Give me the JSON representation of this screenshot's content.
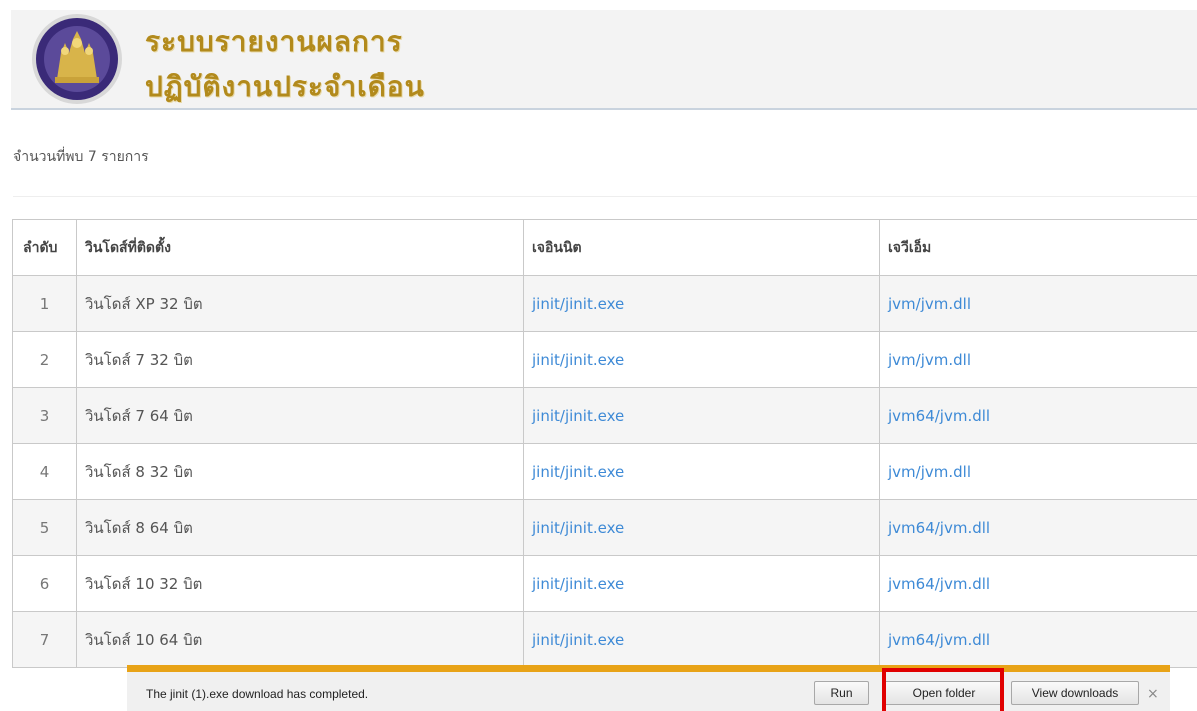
{
  "header": {
    "title_line1": "ระบบรายงานผลการ",
    "title_line2": "ปฏิบัติงานประจำเดือน"
  },
  "summary": {
    "count_text": "จำนวนที่พบ 7 รายการ"
  },
  "table": {
    "headers": [
      "ลำดับ",
      "วินโดส์ที่ติดตั้ง",
      "เจอินนิต",
      "เจวีเอ็ม"
    ],
    "rows": [
      {
        "no": "1",
        "os": "วินโดส์ XP 32 บิต",
        "jinit": "jinit/jinit.exe",
        "jvm": "jvm/jvm.dll"
      },
      {
        "no": "2",
        "os": "วินโดส์ 7 32 บิต",
        "jinit": "jinit/jinit.exe",
        "jvm": "jvm/jvm.dll"
      },
      {
        "no": "3",
        "os": "วินโดส์ 7 64 บิต",
        "jinit": "jinit/jinit.exe",
        "jvm": "jvm64/jvm.dll"
      },
      {
        "no": "4",
        "os": "วินโดส์ 8 32 บิต",
        "jinit": "jinit/jinit.exe",
        "jvm": "jvm/jvm.dll"
      },
      {
        "no": "5",
        "os": "วินโดส์ 8 64 บิต",
        "jinit": "jinit/jinit.exe",
        "jvm": "jvm64/jvm.dll"
      },
      {
        "no": "6",
        "os": "วินโดส์ 10 32 บิต",
        "jinit": "jinit/jinit.exe",
        "jvm": "jvm64/jvm.dll"
      },
      {
        "no": "7",
        "os": "วินโดส์ 10 64 บิต",
        "jinit": "jinit/jinit.exe",
        "jvm": "jvm64/jvm.dll"
      }
    ]
  },
  "download_bar": {
    "message": "The jinit (1).exe download has completed.",
    "run_label": "Run",
    "open_folder_label": "Open folder",
    "view_downloads_label": "View downloads",
    "close_symbol": "×",
    "accent_color": "#e8a317",
    "highlight_color": "#e00000"
  },
  "colors": {
    "title": "#b28a1c",
    "link": "#3e8ad6"
  }
}
